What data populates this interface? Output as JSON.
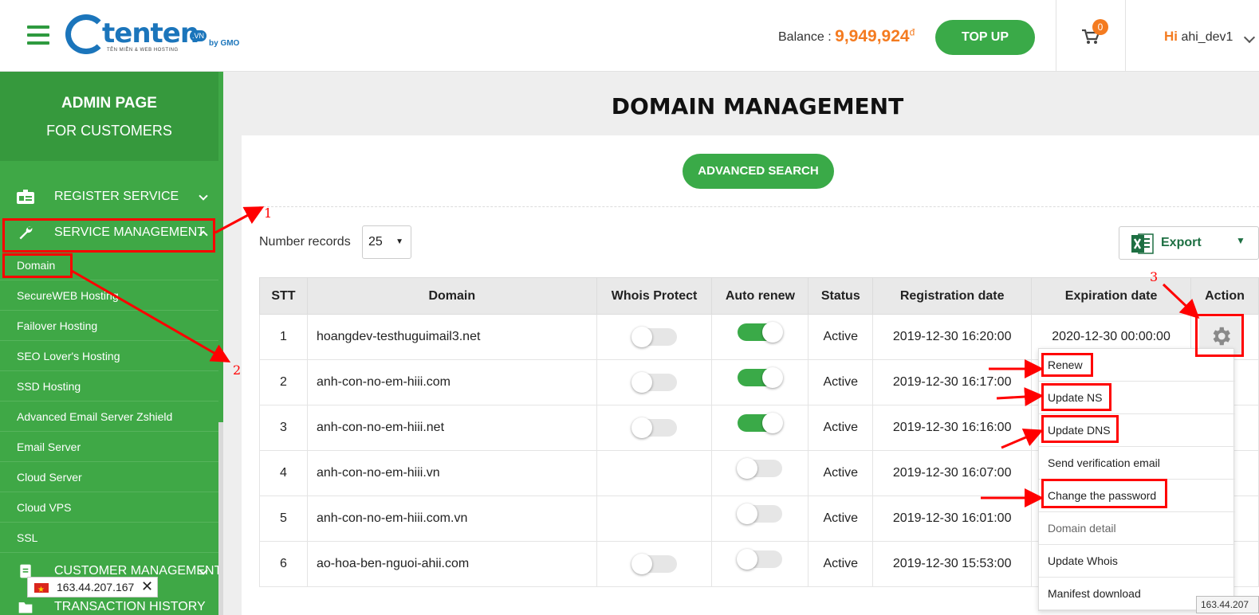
{
  "header": {
    "logo_text": "tenten",
    "logo_badge": ".VN",
    "logo_sub": "TÊN MIỀN & WEB HOSTING",
    "logo_partner": "by GMO",
    "balance_label": "Balance :",
    "balance_amount": "9,949,924",
    "balance_currency": "đ",
    "topup_label": "TOP UP",
    "cart_count": "0",
    "greeting_hi": "Hi",
    "username": "ahi_dev1"
  },
  "sidebar": {
    "title_line1": "ADMIN PAGE",
    "title_line2": "FOR CUSTOMERS",
    "menu": [
      {
        "label": "REGISTER SERVICE",
        "icon": "id-card-icon"
      },
      {
        "label": "SERVICE MANAGEMENT",
        "icon": "wrench-icon"
      },
      {
        "label": "CUSTOMER MANAGEMENT",
        "icon": "document-icon"
      },
      {
        "label": "TRANSACTION HISTORY",
        "icon": "folder-icon"
      }
    ],
    "sub_items": [
      "Domain",
      "SecureWEB Hosting",
      "Failover Hosting",
      "SEO Lover's Hosting",
      "SSD Hosting",
      "Advanced Email Server Zshield",
      "Email Server",
      "Cloud Server",
      "Cloud VPS",
      "SSL"
    ],
    "ip_chip": "163.44.207.167"
  },
  "main": {
    "title": "DOMAIN MANAGEMENT",
    "advanced_search": "ADVANCED SEARCH",
    "number_records_label": "Number records",
    "number_records_value": "25",
    "export_label": "Export",
    "columns": [
      "STT",
      "Domain",
      "Whois Protect",
      "Auto renew",
      "Status",
      "Registration date",
      "Expiration date",
      "Action"
    ],
    "rows": [
      {
        "stt": "1",
        "domain": "hoangdev-testhuguimail3.net",
        "whois": "off",
        "auto": "on",
        "status": "Active",
        "reg": "2019-12-30 16:20:00",
        "exp": "2020-12-30 00:00:00"
      },
      {
        "stt": "2",
        "domain": "anh-con-no-em-hiii.com",
        "whois": "off",
        "auto": "on",
        "status": "Active",
        "reg": "2019-12-30 16:17:00",
        "exp": ""
      },
      {
        "stt": "3",
        "domain": "anh-con-no-em-hiii.net",
        "whois": "off",
        "auto": "on",
        "status": "Active",
        "reg": "2019-12-30 16:16:00",
        "exp": ""
      },
      {
        "stt": "4",
        "domain": "anh-con-no-em-hiii.vn",
        "whois": "none",
        "auto": "off",
        "status": "Active",
        "reg": "2019-12-30 16:07:00",
        "exp": ""
      },
      {
        "stt": "5",
        "domain": "anh-con-no-em-hiii.com.vn",
        "whois": "none",
        "auto": "off",
        "status": "Active",
        "reg": "2019-12-30 16:01:00",
        "exp": ""
      },
      {
        "stt": "6",
        "domain": "ao-hoa-ben-nguoi-ahii.com",
        "whois": "off",
        "auto": "off",
        "status": "Active",
        "reg": "2019-12-30 15:53:00",
        "exp": ""
      }
    ],
    "action_menu": [
      "Renew",
      "Update NS",
      "Update DNS",
      "Send verification email",
      "Change the password",
      "Domain detail",
      "Update Whois",
      "Manifest download"
    ],
    "ip_tooltip": "163.44.207"
  },
  "annotations": {
    "labels": [
      "1",
      "2",
      "3"
    ],
    "color": "#ff0000"
  },
  "colors": {
    "brand_green": "#3aaa48",
    "sidebar_green": "#3fa846",
    "accent_orange": "#f47b20",
    "logo_blue": "#1b75bb"
  }
}
